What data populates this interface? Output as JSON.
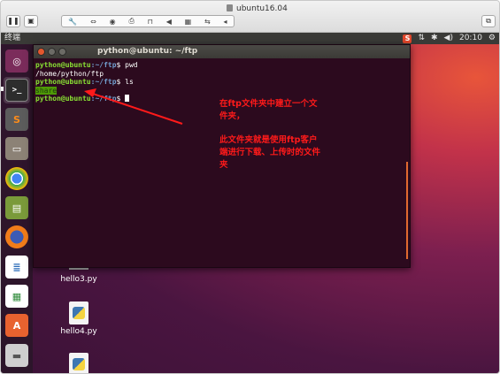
{
  "vm": {
    "title": "ubuntu16.04",
    "toolbar_icons": [
      "wrench-icon",
      "arrows-icon",
      "disk-icon",
      "printer-icon",
      "lock-icon",
      "speaker-icon",
      "camera-icon",
      "usb-icon",
      "share-icon"
    ]
  },
  "panel": {
    "app_name": "终端",
    "time": "20:10",
    "icons": [
      "sogou-icon",
      "network-icon",
      "bluetooth-icon",
      "volume-icon",
      "gear-icon"
    ]
  },
  "launcher": {
    "items": [
      "ubuntu-logo",
      "terminal",
      "sublime-text",
      "file-manager",
      "chrome",
      "book",
      "firefox",
      "libreoffice-writer",
      "libreoffice-calc",
      "software-center",
      "usb-drive"
    ]
  },
  "terminal": {
    "title": "python@ubuntu: ~/ftp",
    "lines": [
      {
        "user": "python@ubuntu",
        "path": ":~/ftp",
        "cmd": "$ pwd"
      },
      {
        "output": "/home/python/ftp"
      },
      {
        "user": "python@ubuntu",
        "path": ":~/ftp",
        "cmd": "$ ls"
      },
      {
        "dir": "share"
      },
      {
        "user": "python@ubuntu",
        "path": ":~/ftp",
        "cmd": "$ "
      }
    ]
  },
  "annotation": {
    "line1": "在ftp文件夹中建立一个文件夹，",
    "line2": "此文件夹就是使用ftp客户端进行下载、上传时的文件夹",
    "color": "#ff1a1a"
  },
  "desktop_files": [
    "hello3.py",
    "hello4.py"
  ]
}
